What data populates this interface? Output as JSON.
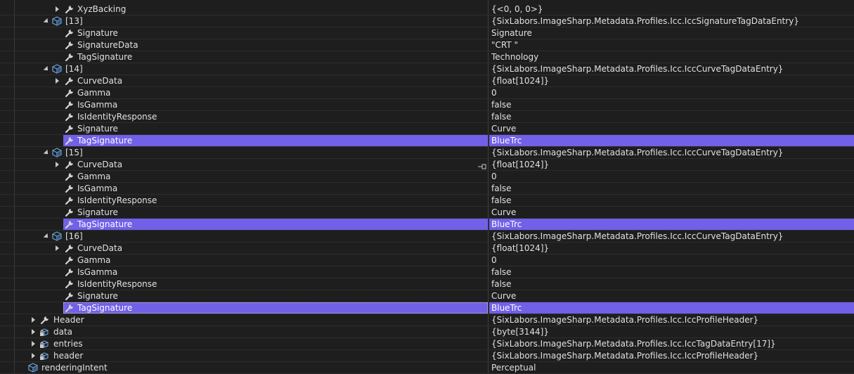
{
  "rows": [
    {
      "name": "XyzBacking",
      "value": "{<0, 0, 0>}",
      "icon": "wrench-icon",
      "toggle": "collapsed",
      "level": 5
    },
    {
      "name": "[13]",
      "value": "{SixLabors.ImageSharp.Metadata.Profiles.Icc.IccSignatureTagDataEntry}",
      "icon": "cube-icon",
      "toggle": "expanded",
      "level": 4
    },
    {
      "name": "Signature",
      "value": "Signature",
      "icon": "wrench-icon",
      "toggle": "none",
      "level": 5
    },
    {
      "name": "SignatureData",
      "value": "\"CRT \"",
      "icon": "wrench-icon",
      "toggle": "none",
      "level": 5
    },
    {
      "name": "TagSignature",
      "value": "Technology",
      "icon": "wrench-icon",
      "toggle": "none",
      "level": 5
    },
    {
      "name": "[14]",
      "value": "{SixLabors.ImageSharp.Metadata.Profiles.Icc.IccCurveTagDataEntry}",
      "icon": "cube-icon",
      "toggle": "expanded",
      "level": 4
    },
    {
      "name": "CurveData",
      "value": "{float[1024]}",
      "icon": "wrench-icon",
      "toggle": "collapsed",
      "level": 5
    },
    {
      "name": "Gamma",
      "value": "0",
      "icon": "wrench-icon",
      "toggle": "none",
      "level": 5
    },
    {
      "name": "IsGamma",
      "value": "false",
      "icon": "wrench-icon",
      "toggle": "none",
      "level": 5
    },
    {
      "name": "IsIdentityResponse",
      "value": "false",
      "icon": "wrench-icon",
      "toggle": "none",
      "level": 5
    },
    {
      "name": "Signature",
      "value": "Curve",
      "icon": "wrench-icon",
      "toggle": "none",
      "level": 5
    },
    {
      "name": "TagSignature",
      "value": "BlueTrc",
      "icon": "wrench-icon",
      "toggle": "none",
      "level": 5,
      "highlight": true
    },
    {
      "name": "[15]",
      "value": "{SixLabors.ImageSharp.Metadata.Profiles.Icc.IccCurveTagDataEntry}",
      "icon": "cube-icon",
      "toggle": "expanded",
      "level": 4
    },
    {
      "name": "CurveData",
      "value": "{float[1024]}",
      "icon": "wrench-icon",
      "toggle": "collapsed",
      "level": 5,
      "pin": true
    },
    {
      "name": "Gamma",
      "value": "0",
      "icon": "wrench-icon",
      "toggle": "none",
      "level": 5
    },
    {
      "name": "IsGamma",
      "value": "false",
      "icon": "wrench-icon",
      "toggle": "none",
      "level": 5
    },
    {
      "name": "IsIdentityResponse",
      "value": "false",
      "icon": "wrench-icon",
      "toggle": "none",
      "level": 5
    },
    {
      "name": "Signature",
      "value": "Curve",
      "icon": "wrench-icon",
      "toggle": "none",
      "level": 5
    },
    {
      "name": "TagSignature",
      "value": "BlueTrc",
      "icon": "wrench-icon",
      "toggle": "none",
      "level": 5,
      "highlight": true
    },
    {
      "name": "[16]",
      "value": "{SixLabors.ImageSharp.Metadata.Profiles.Icc.IccCurveTagDataEntry}",
      "icon": "cube-icon",
      "toggle": "expanded",
      "level": 4
    },
    {
      "name": "CurveData",
      "value": "{float[1024]}",
      "icon": "wrench-icon",
      "toggle": "collapsed",
      "level": 5
    },
    {
      "name": "Gamma",
      "value": "0",
      "icon": "wrench-icon",
      "toggle": "none",
      "level": 5
    },
    {
      "name": "IsGamma",
      "value": "false",
      "icon": "wrench-icon",
      "toggle": "none",
      "level": 5
    },
    {
      "name": "IsIdentityResponse",
      "value": "false",
      "icon": "wrench-icon",
      "toggle": "none",
      "level": 5
    },
    {
      "name": "Signature",
      "value": "Curve",
      "icon": "wrench-icon",
      "toggle": "none",
      "level": 5
    },
    {
      "name": "TagSignature",
      "value": "BlueTrc",
      "icon": "wrench-icon",
      "toggle": "none",
      "level": 5,
      "highlight": true,
      "current": true
    },
    {
      "name": "Header",
      "value": "{SixLabors.ImageSharp.Metadata.Profiles.Icc.IccProfileHeader}",
      "icon": "wrench-icon",
      "toggle": "collapsed",
      "level": 2
    },
    {
      "name": "data",
      "value": "{byte[3144]}",
      "icon": "locked-field-icon",
      "toggle": "collapsed",
      "level": 2
    },
    {
      "name": "entries",
      "value": "{SixLabors.ImageSharp.Metadata.Profiles.Icc.IccTagDataEntry[17]}",
      "icon": "locked-field-icon",
      "toggle": "collapsed",
      "level": 2
    },
    {
      "name": "header",
      "value": "{SixLabors.ImageSharp.Metadata.Profiles.Icc.IccProfileHeader}",
      "icon": "locked-field-icon",
      "toggle": "collapsed",
      "level": 2
    },
    {
      "name": "renderingIntent",
      "value": "Perceptual",
      "icon": "cube-icon",
      "toggle": "none",
      "level": 1
    }
  ],
  "colors": {
    "background": "#1e1e1e",
    "highlight": "#7160e8",
    "text": "#e0e0e0",
    "cube": "#6fa3d8",
    "wrench": "#d4d4d4"
  }
}
